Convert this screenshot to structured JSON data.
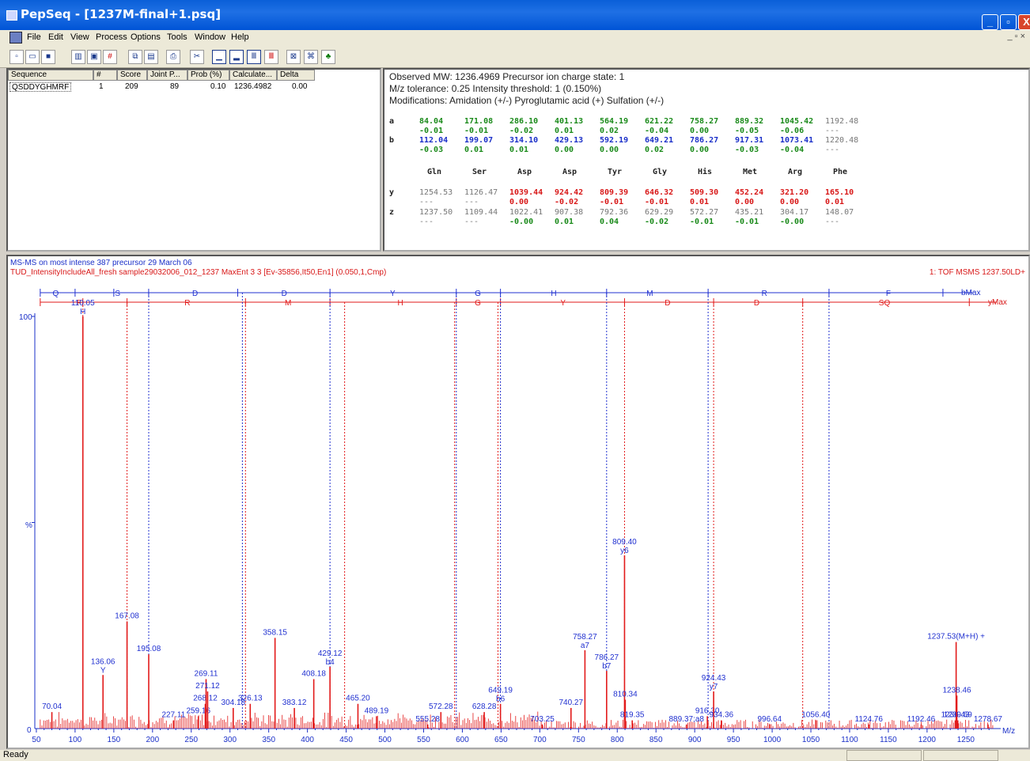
{
  "window": {
    "title": "PepSeq - [1237M-final+1.psq]",
    "minimize": "_",
    "restore": "▫",
    "close": "X"
  },
  "menu": [
    "File",
    "Edit",
    "View",
    "Process",
    "Options",
    "Tools",
    "Window",
    "Help"
  ],
  "mdi_controls": "_ ▫ ×",
  "table": {
    "headers": [
      "Sequence",
      "#",
      "Score",
      "Joint P...",
      "Prob (%)",
      "Calculate...",
      "Delta"
    ],
    "rows": [
      [
        "QSDDYGHMRF",
        "1",
        "209",
        "89",
        "0.10",
        "1236.4982",
        "0.00"
      ]
    ]
  },
  "info": {
    "line1": "Observed MW: 1236.4969    Precursor ion charge state: 1",
    "line2": "M/z tolerance: 0.25    Intensity threshold: 1 (0.150%)",
    "line3": "Modifications: Amidation (+/-) Pyroglutamic acid (+) Sulfation (+/-)"
  },
  "ions": {
    "row_labels": [
      "a",
      "b",
      "y",
      "z"
    ],
    "residues": [
      "Gln",
      "Ser",
      "Asp",
      "Asp",
      "Tyr",
      "Gly",
      "His",
      "Met",
      "Arg",
      "Phe"
    ],
    "a": [
      "84.04",
      "171.08",
      "286.10",
      "401.13",
      "564.19",
      "621.22",
      "758.27",
      "889.32",
      "1045.42",
      "1192.48"
    ],
    "a_delta": [
      "-0.01",
      "-0.01",
      "-0.02",
      "0.01",
      "0.02",
      "-0.04",
      "0.00",
      "-0.05",
      "-0.06",
      "---"
    ],
    "b": [
      "112.04",
      "199.07",
      "314.10",
      "429.13",
      "592.19",
      "649.21",
      "786.27",
      "917.31",
      "1073.41",
      "1220.48"
    ],
    "b_delta": [
      "-0.03",
      "0.01",
      "0.01",
      "0.00",
      "0.00",
      "0.02",
      "0.00",
      "-0.03",
      "-0.04",
      "---"
    ],
    "y": [
      "1254.53",
      "1126.47",
      "1039.44",
      "924.42",
      "809.39",
      "646.32",
      "509.30",
      "452.24",
      "321.20",
      "165.10"
    ],
    "y_delta": [
      "---",
      "---",
      "0.00",
      "-0.02",
      "-0.01",
      "-0.01",
      "0.01",
      "0.00",
      "0.00",
      "0.01"
    ],
    "z": [
      "1237.50",
      "1109.44",
      "1022.41",
      "907.38",
      "792.36",
      "629.29",
      "572.27",
      "435.21",
      "304.17",
      "148.07"
    ],
    "z_delta": [
      "---",
      "---",
      "-0.00",
      "0.01",
      "0.04",
      "-0.02",
      "-0.01",
      "-0.01",
      "-0.00",
      "---"
    ],
    "colors": {
      "match_green": "#1a8a1a",
      "match_blue": "#1a2fc8",
      "match_red": "#d81818",
      "unmatched": "#777777"
    }
  },
  "spectrum": {
    "header1": "MS-MS on most intense 387 precursor 29 March 06",
    "header2": "TUD_IntensityIncludeAll_fresh sample29032006_012_1237  MaxEnt 3  3 [Ev-35856,It50,En1] (0.050,1,Cmp)",
    "header_right": "1: TOF MSMS 1237.50LD+",
    "ylabel": "%",
    "y100": "100",
    "y0": "0",
    "xunit": "M/z",
    "bmax_label": "bMax",
    "ymax_label": "yMax",
    "b_ladder": [
      "Q",
      "S",
      "D",
      "D",
      "Y",
      "G",
      "H",
      "M",
      "R",
      "F"
    ],
    "y_ladder": [
      "F",
      "R",
      "M",
      "H",
      "G",
      "Y",
      "D",
      "D",
      "SQ"
    ],
    "colors": {
      "peaks": "#e21a1a",
      "b_series": "#2030d0",
      "y_series": "#e21a1a"
    }
  },
  "chart_data": {
    "type": "bar",
    "xlabel": "M/z",
    "ylabel": "%",
    "xlim": [
      48,
      1290
    ],
    "ylim": [
      0,
      100
    ],
    "xticks": [
      50,
      100,
      150,
      200,
      250,
      300,
      350,
      400,
      450,
      500,
      550,
      600,
      650,
      700,
      750,
      800,
      850,
      900,
      950,
      1000,
      1050,
      1100,
      1150,
      1200,
      1250
    ],
    "peaks": [
      {
        "mz": 70.04,
        "rel": 4,
        "label": "70.04"
      },
      {
        "mz": 110.05,
        "rel": 100,
        "label": "110.05",
        "ion": "H"
      },
      {
        "mz": 136.06,
        "rel": 13,
        "label": "136.06",
        "ion": "Y"
      },
      {
        "mz": 167.08,
        "rel": 26,
        "label": "167.08"
      },
      {
        "mz": 195.08,
        "rel": 18,
        "label": "195.08"
      },
      {
        "mz": 227.11,
        "rel": 2,
        "label": "227.11"
      },
      {
        "mz": 259.16,
        "rel": 3,
        "label": "259.16"
      },
      {
        "mz": 268.12,
        "rel": 6,
        "label": "268.12"
      },
      {
        "mz": 269.11,
        "rel": 12,
        "label": "269.11"
      },
      {
        "mz": 271.12,
        "rel": 9,
        "label": "271.12"
      },
      {
        "mz": 304.18,
        "rel": 5,
        "label": "304.18"
      },
      {
        "mz": 326.13,
        "rel": 6,
        "label": "326.13"
      },
      {
        "mz": 358.15,
        "rel": 22,
        "label": "358.15"
      },
      {
        "mz": 383.12,
        "rel": 5,
        "label": "383.12"
      },
      {
        "mz": 408.18,
        "rel": 12,
        "label": "408.18"
      },
      {
        "mz": 429.12,
        "rel": 15,
        "label": "429.12",
        "ion": "b4"
      },
      {
        "mz": 465.2,
        "rel": 6,
        "label": "465.20"
      },
      {
        "mz": 489.19,
        "rel": 3,
        "label": "489.19"
      },
      {
        "mz": 555.28,
        "rel": 1,
        "label": "555.28"
      },
      {
        "mz": 572.28,
        "rel": 4,
        "label": "572.28"
      },
      {
        "mz": 628.28,
        "rel": 4,
        "label": "628.28"
      },
      {
        "mz": 649.19,
        "rel": 6,
        "label": "649.19",
        "ion": "b6"
      },
      {
        "mz": 703.25,
        "rel": 1,
        "label": "703.25"
      },
      {
        "mz": 740.27,
        "rel": 5,
        "label": "740.27"
      },
      {
        "mz": 758.27,
        "rel": 19,
        "label": "758.27",
        "ion": "a7"
      },
      {
        "mz": 786.27,
        "rel": 14,
        "label": "786.27",
        "ion": "b7"
      },
      {
        "mz": 809.4,
        "rel": 42,
        "label": "809.40",
        "ion": "y6"
      },
      {
        "mz": 810.34,
        "rel": 7,
        "label": "810.34"
      },
      {
        "mz": 819.35,
        "rel": 2,
        "label": "819.35"
      },
      {
        "mz": 889.37,
        "rel": 1,
        "label": "889.37;a8"
      },
      {
        "mz": 916.3,
        "rel": 3,
        "label": "916.30"
      },
      {
        "mz": 924.43,
        "rel": 9,
        "label": "924.43",
        "ion": "y7"
      },
      {
        "mz": 934.36,
        "rel": 2,
        "label": "934.36"
      },
      {
        "mz": 996.64,
        "rel": 1,
        "label": "996.64"
      },
      {
        "mz": 1056.4,
        "rel": 2,
        "label": "1056.40"
      },
      {
        "mz": 1124.76,
        "rel": 1,
        "label": "1124.76"
      },
      {
        "mz": 1192.46,
        "rel": 1,
        "label": "1192.46"
      },
      {
        "mz": 1236.43,
        "rel": 2,
        "label": "1236.43"
      },
      {
        "mz": 1237.53,
        "rel": 21,
        "label": "1237.53(M+H) +"
      },
      {
        "mz": 1238.46,
        "rel": 8,
        "label": "1238.46"
      },
      {
        "mz": 1239.69,
        "rel": 2,
        "label": "1239.69"
      },
      {
        "mz": 1278.67,
        "rel": 1,
        "label": "1278.67"
      }
    ],
    "b_ladder_mz": [
      110.05,
      167.08,
      195.08,
      310,
      320,
      429.12,
      592.19,
      649.21,
      786.27,
      917.31,
      1073.41,
      1220.48
    ],
    "y_ladder_mz": [
      110.05,
      167.08,
      320,
      429.12,
      592.19,
      649.21,
      809.4,
      924.43,
      1039.44,
      1254.53
    ]
  },
  "status": {
    "text": "Ready"
  }
}
